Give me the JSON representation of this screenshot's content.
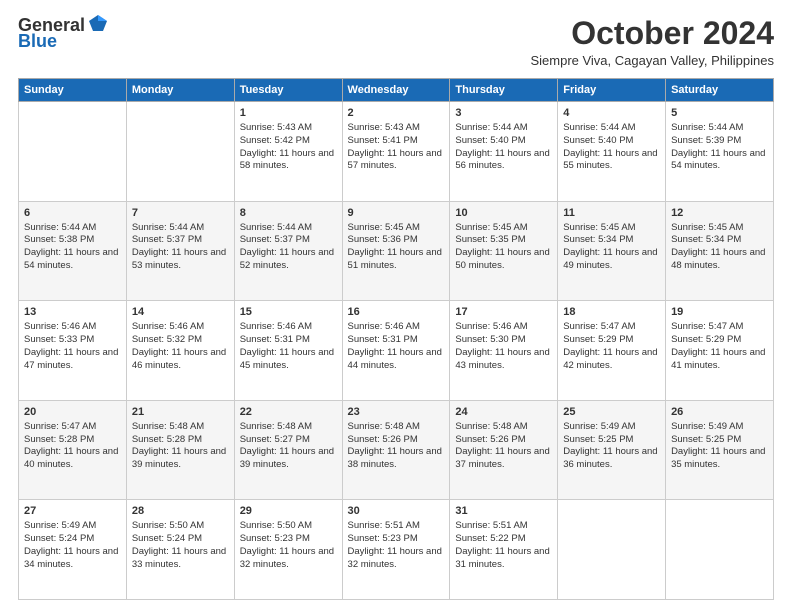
{
  "logo": {
    "general": "General",
    "blue": "Blue"
  },
  "header": {
    "title": "October 2024",
    "subtitle": "Siempre Viva, Cagayan Valley, Philippines"
  },
  "days_of_week": [
    "Sunday",
    "Monday",
    "Tuesday",
    "Wednesday",
    "Thursday",
    "Friday",
    "Saturday"
  ],
  "weeks": [
    [
      {
        "day": "",
        "info": ""
      },
      {
        "day": "",
        "info": ""
      },
      {
        "day": "1",
        "info": "Sunrise: 5:43 AM\nSunset: 5:42 PM\nDaylight: 11 hours and 58 minutes."
      },
      {
        "day": "2",
        "info": "Sunrise: 5:43 AM\nSunset: 5:41 PM\nDaylight: 11 hours and 57 minutes."
      },
      {
        "day": "3",
        "info": "Sunrise: 5:44 AM\nSunset: 5:40 PM\nDaylight: 11 hours and 56 minutes."
      },
      {
        "day": "4",
        "info": "Sunrise: 5:44 AM\nSunset: 5:40 PM\nDaylight: 11 hours and 55 minutes."
      },
      {
        "day": "5",
        "info": "Sunrise: 5:44 AM\nSunset: 5:39 PM\nDaylight: 11 hours and 54 minutes."
      }
    ],
    [
      {
        "day": "6",
        "info": "Sunrise: 5:44 AM\nSunset: 5:38 PM\nDaylight: 11 hours and 54 minutes."
      },
      {
        "day": "7",
        "info": "Sunrise: 5:44 AM\nSunset: 5:37 PM\nDaylight: 11 hours and 53 minutes."
      },
      {
        "day": "8",
        "info": "Sunrise: 5:44 AM\nSunset: 5:37 PM\nDaylight: 11 hours and 52 minutes."
      },
      {
        "day": "9",
        "info": "Sunrise: 5:45 AM\nSunset: 5:36 PM\nDaylight: 11 hours and 51 minutes."
      },
      {
        "day": "10",
        "info": "Sunrise: 5:45 AM\nSunset: 5:35 PM\nDaylight: 11 hours and 50 minutes."
      },
      {
        "day": "11",
        "info": "Sunrise: 5:45 AM\nSunset: 5:34 PM\nDaylight: 11 hours and 49 minutes."
      },
      {
        "day": "12",
        "info": "Sunrise: 5:45 AM\nSunset: 5:34 PM\nDaylight: 11 hours and 48 minutes."
      }
    ],
    [
      {
        "day": "13",
        "info": "Sunrise: 5:46 AM\nSunset: 5:33 PM\nDaylight: 11 hours and 47 minutes."
      },
      {
        "day": "14",
        "info": "Sunrise: 5:46 AM\nSunset: 5:32 PM\nDaylight: 11 hours and 46 minutes."
      },
      {
        "day": "15",
        "info": "Sunrise: 5:46 AM\nSunset: 5:31 PM\nDaylight: 11 hours and 45 minutes."
      },
      {
        "day": "16",
        "info": "Sunrise: 5:46 AM\nSunset: 5:31 PM\nDaylight: 11 hours and 44 minutes."
      },
      {
        "day": "17",
        "info": "Sunrise: 5:46 AM\nSunset: 5:30 PM\nDaylight: 11 hours and 43 minutes."
      },
      {
        "day": "18",
        "info": "Sunrise: 5:47 AM\nSunset: 5:29 PM\nDaylight: 11 hours and 42 minutes."
      },
      {
        "day": "19",
        "info": "Sunrise: 5:47 AM\nSunset: 5:29 PM\nDaylight: 11 hours and 41 minutes."
      }
    ],
    [
      {
        "day": "20",
        "info": "Sunrise: 5:47 AM\nSunset: 5:28 PM\nDaylight: 11 hours and 40 minutes."
      },
      {
        "day": "21",
        "info": "Sunrise: 5:48 AM\nSunset: 5:28 PM\nDaylight: 11 hours and 39 minutes."
      },
      {
        "day": "22",
        "info": "Sunrise: 5:48 AM\nSunset: 5:27 PM\nDaylight: 11 hours and 39 minutes."
      },
      {
        "day": "23",
        "info": "Sunrise: 5:48 AM\nSunset: 5:26 PM\nDaylight: 11 hours and 38 minutes."
      },
      {
        "day": "24",
        "info": "Sunrise: 5:48 AM\nSunset: 5:26 PM\nDaylight: 11 hours and 37 minutes."
      },
      {
        "day": "25",
        "info": "Sunrise: 5:49 AM\nSunset: 5:25 PM\nDaylight: 11 hours and 36 minutes."
      },
      {
        "day": "26",
        "info": "Sunrise: 5:49 AM\nSunset: 5:25 PM\nDaylight: 11 hours and 35 minutes."
      }
    ],
    [
      {
        "day": "27",
        "info": "Sunrise: 5:49 AM\nSunset: 5:24 PM\nDaylight: 11 hours and 34 minutes."
      },
      {
        "day": "28",
        "info": "Sunrise: 5:50 AM\nSunset: 5:24 PM\nDaylight: 11 hours and 33 minutes."
      },
      {
        "day": "29",
        "info": "Sunrise: 5:50 AM\nSunset: 5:23 PM\nDaylight: 11 hours and 32 minutes."
      },
      {
        "day": "30",
        "info": "Sunrise: 5:51 AM\nSunset: 5:23 PM\nDaylight: 11 hours and 32 minutes."
      },
      {
        "day": "31",
        "info": "Sunrise: 5:51 AM\nSunset: 5:22 PM\nDaylight: 11 hours and 31 minutes."
      },
      {
        "day": "",
        "info": ""
      },
      {
        "day": "",
        "info": ""
      }
    ]
  ]
}
